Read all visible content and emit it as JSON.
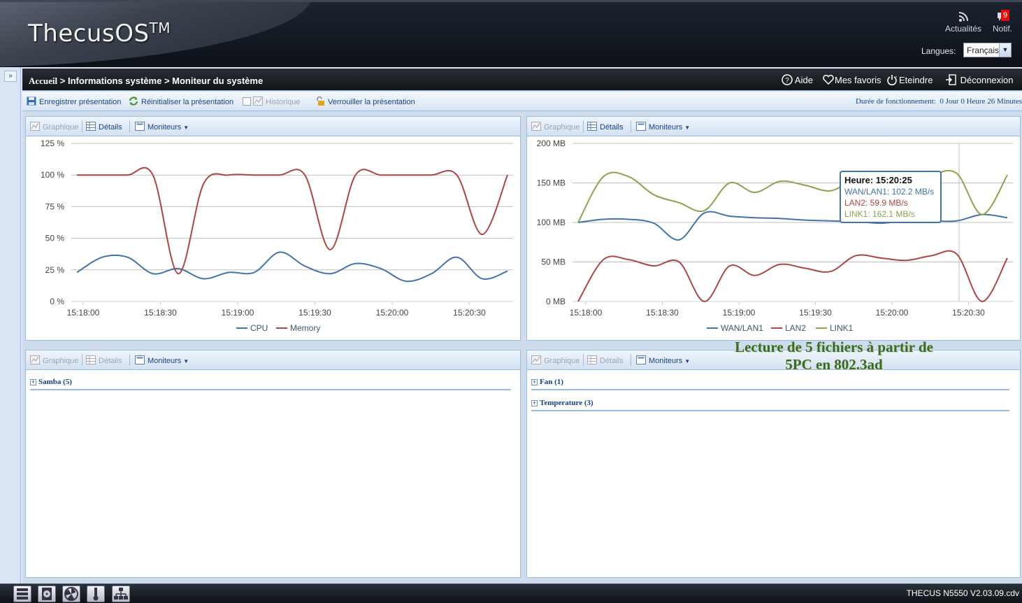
{
  "header": {
    "logo_text": "ThecusOS",
    "logo_tm": "TM",
    "news_label": "Actualités",
    "notif_label": "Notif.",
    "notif_count": "9",
    "language_label": "Langues:",
    "language_value": "Français"
  },
  "titlebar": {
    "breadcrumb_home": "Accueil",
    "breadcrumb_rest": " > Informations système > Moniteur du système",
    "help": "Aide",
    "favorites": "Mes favoris",
    "shutdown": "Eteindre",
    "logout": "Déconnexion"
  },
  "toolbar": {
    "save_layout": "Enregistrer présentation",
    "reset_layout": "Réinitialiser la présentation",
    "history": "Historique",
    "lock_layout": "Verrouiller la présentation",
    "uptime_label": "Durée de fonctionnement:",
    "uptime_value": "0 Jour 0 Heure 26 Minutes"
  },
  "portlet_tools": {
    "graph": "Graphique",
    "details": "Détails",
    "monitors": "Moniteurs"
  },
  "groups": {
    "samba": "Samba (5)",
    "fan": "Fan (1)",
    "temperature": "Temperature (3)"
  },
  "caption": {
    "line1": "Lecture de 5 fichiers à partir de",
    "line2": "5PC en 802.3ad"
  },
  "tooltip": {
    "time": "Heure: 15:20:25",
    "wan": "WAN/LAN1: 102.2 MB/s",
    "lan2": "LAN2: 59.9 MB/s",
    "link1": "LINK1: 162.1 MB/s"
  },
  "colors": {
    "series_blue": "#4572a7",
    "series_red": "#aa4643",
    "series_green": "#89a54e"
  },
  "footer": {
    "version": "THECUS N5550 V2.03.09.cdv"
  },
  "chart_data": [
    {
      "type": "line",
      "x": [
        "15:18:00",
        "15:18:10",
        "15:18:20",
        "15:18:30",
        "15:18:40",
        "15:18:50",
        "15:19:00",
        "15:19:10",
        "15:19:20",
        "15:19:30",
        "15:19:40",
        "15:19:50",
        "15:20:00",
        "15:20:10",
        "15:20:20",
        "15:20:30",
        "15:20:40"
      ],
      "xticks": [
        "15:18:00",
        "15:18:30",
        "15:19:00",
        "15:19:30",
        "15:20:00",
        "15:20:30"
      ],
      "yticks": [
        "0 %",
        "25 %",
        "50 %",
        "75 %",
        "100 %",
        "125 %"
      ],
      "ylim": [
        0,
        125
      ],
      "series": [
        {
          "name": "CPU",
          "color": "#4572a7",
          "values": [
            23,
            35,
            35,
            22,
            26,
            18,
            23,
            23,
            39,
            28,
            22,
            30,
            26,
            16,
            22,
            35,
            18,
            24
          ]
        },
        {
          "name": "Memory",
          "color": "#aa4643",
          "values": [
            100,
            100,
            100,
            100,
            22,
            93,
            100,
            100,
            100,
            100,
            41,
            100,
            100,
            100,
            100,
            100,
            53,
            100
          ]
        }
      ],
      "legend": "bottom-center"
    },
    {
      "type": "line",
      "xticks": [
        "15:18:00",
        "15:18:30",
        "15:19:00",
        "15:19:30",
        "15:20:00",
        "15:20:30"
      ],
      "yticks": [
        "0 MB",
        "50 MB",
        "100 MB",
        "150 MB",
        "200 MB"
      ],
      "ylim": [
        0,
        200
      ],
      "series": [
        {
          "name": "WAN/LAN1",
          "color": "#4572a7",
          "values": [
            100,
            104,
            104,
            99,
            78,
            112,
            108,
            106,
            105,
            103,
            102,
            101,
            99,
            102,
            102,
            102,
            110,
            106
          ]
        },
        {
          "name": "LAN2",
          "color": "#aa4643",
          "values": [
            0,
            53,
            53,
            45,
            50,
            0,
            45,
            33,
            47,
            42,
            38,
            58,
            55,
            52,
            58,
            60,
            0,
            55
          ]
        },
        {
          "name": "LINK1",
          "color": "#89a54e",
          "values": [
            100,
            158,
            158,
            135,
            125,
            115,
            150,
            138,
            152,
            147,
            140,
            155,
            154,
            150,
            160,
            162,
            110,
            160
          ]
        }
      ],
      "legend": "bottom-center"
    }
  ]
}
